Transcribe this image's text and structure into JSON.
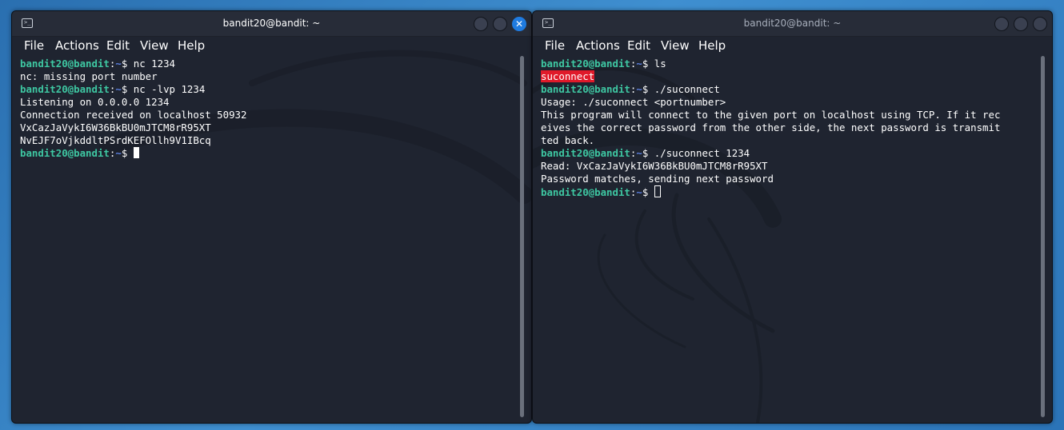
{
  "left_window": {
    "title": "bandit20@bandit: ~",
    "menu": [
      "File",
      "Actions",
      "Edit",
      "View",
      "Help"
    ],
    "close_glyph": "✕",
    "lines": [
      {
        "user": "bandit20@bandit",
        "sep": ":",
        "path": "~",
        "dollar": "$",
        "cmd": " nc 1234"
      },
      {
        "text": "nc: missing port number"
      },
      {
        "user": "bandit20@bandit",
        "sep": ":",
        "path": "~",
        "dollar": "$",
        "cmd": " nc -lvp 1234"
      },
      {
        "text": "Listening on 0.0.0.0 1234"
      },
      {
        "text": "Connection received on localhost 50932"
      },
      {
        "text": "VxCazJaVykI6W36BkBU0mJTCM8rR95XT"
      },
      {
        "text": "NvEJF7oVjkddltPSrdKEFOllh9V1IBcq"
      },
      {
        "user": "bandit20@bandit",
        "sep": ":",
        "path": "~",
        "dollar": "$",
        "cmd": " "
      }
    ]
  },
  "right_window": {
    "title": "bandit20@bandit: ~",
    "menu": [
      "File",
      "Actions",
      "Edit",
      "View",
      "Help"
    ],
    "lines": [
      {
        "user": "bandit20@bandit",
        "sep": ":",
        "path": "~",
        "dollar": "$",
        "cmd": " ls"
      },
      {
        "highlight": "suconnect"
      },
      {
        "user": "bandit20@bandit",
        "sep": ":",
        "path": "~",
        "dollar": "$",
        "cmd": " ./suconnect"
      },
      {
        "text": "Usage: ./suconnect <portnumber>"
      },
      {
        "text": "This program will connect to the given port on localhost using TCP. If it rec"
      },
      {
        "text": "eives the correct password from the other side, the next password is transmit"
      },
      {
        "text": "ted back."
      },
      {
        "user": "bandit20@bandit",
        "sep": ":",
        "path": "~",
        "dollar": "$",
        "cmd": " ./suconnect 1234"
      },
      {
        "text": "Read: VxCazJaVykI6W36BkBU0mJTCM8rR95XT"
      },
      {
        "text": "Password matches, sending next password"
      },
      {
        "user": "bandit20@bandit",
        "sep": ":",
        "path": "~",
        "dollar": "$",
        "cmd": " "
      }
    ]
  },
  "colors": {
    "prompt_user": "#3ec7a2",
    "prompt_path": "#5a7fe0",
    "highlight_bg": "#e01a2a",
    "close_button": "#1f7be0"
  },
  "icons": {
    "window_icon": "terminal-icon",
    "close": "close-icon",
    "maximize": "maximize-icon",
    "minimize": "minimize-icon"
  }
}
